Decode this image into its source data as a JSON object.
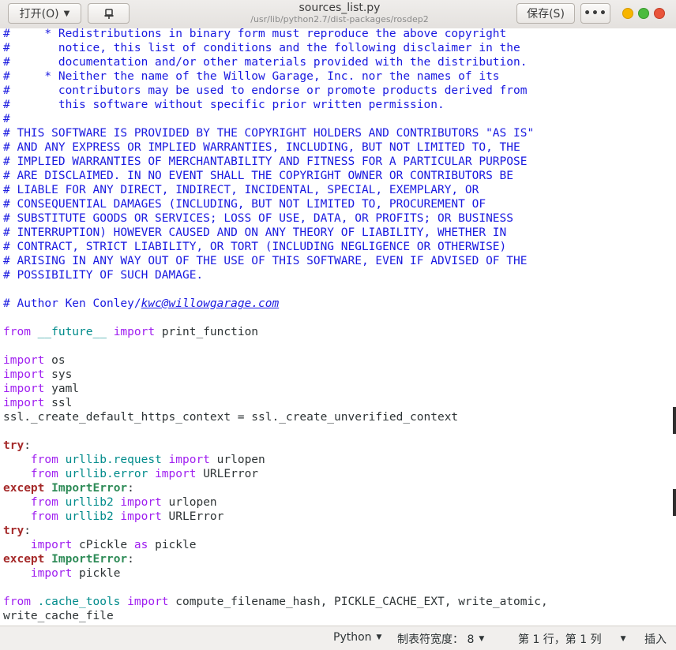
{
  "header": {
    "open_label": "打开(O)",
    "pin_icon": "pin-icon",
    "title": "sources_list.py",
    "subtitle": "/usr/lib/python2.7/dist-packages/rosdep2",
    "save_label": "保存(S)",
    "menu_label": "•••",
    "colors": {
      "minimize": "#f7b500",
      "maximize": "#4cbb3f",
      "close": "#e9543a"
    }
  },
  "editor": {
    "lines": [
      [
        [
          "c",
          "#     * Redistributions in binary form must reproduce the above copyright"
        ]
      ],
      [
        [
          "c",
          "#       notice, this list of conditions and the following disclaimer in the"
        ]
      ],
      [
        [
          "c",
          "#       documentation and/or other materials provided with the distribution."
        ]
      ],
      [
        [
          "c",
          "#     * Neither the name of the Willow Garage, Inc. nor the names of its"
        ]
      ],
      [
        [
          "c",
          "#       contributors may be used to endorse or promote products derived from"
        ]
      ],
      [
        [
          "c",
          "#       this software without specific prior written permission."
        ]
      ],
      [
        [
          "c",
          "#"
        ]
      ],
      [
        [
          "c",
          "# THIS SOFTWARE IS PROVIDED BY THE COPYRIGHT HOLDERS AND CONTRIBUTORS \"AS IS\""
        ]
      ],
      [
        [
          "c",
          "# AND ANY EXPRESS OR IMPLIED WARRANTIES, INCLUDING, BUT NOT LIMITED TO, THE"
        ]
      ],
      [
        [
          "c",
          "# IMPLIED WARRANTIES OF MERCHANTABILITY AND FITNESS FOR A PARTICULAR PURPOSE"
        ]
      ],
      [
        [
          "c",
          "# ARE DISCLAIMED. IN NO EVENT SHALL THE COPYRIGHT OWNER OR CONTRIBUTORS BE"
        ]
      ],
      [
        [
          "c",
          "# LIABLE FOR ANY DIRECT, INDIRECT, INCIDENTAL, SPECIAL, EXEMPLARY, OR"
        ]
      ],
      [
        [
          "c",
          "# CONSEQUENTIAL DAMAGES (INCLUDING, BUT NOT LIMITED TO, PROCUREMENT OF"
        ]
      ],
      [
        [
          "c",
          "# SUBSTITUTE GOODS OR SERVICES; LOSS OF USE, DATA, OR PROFITS; OR BUSINESS"
        ]
      ],
      [
        [
          "c",
          "# INTERRUPTION) HOWEVER CAUSED AND ON ANY THEORY OF LIABILITY, WHETHER IN"
        ]
      ],
      [
        [
          "c",
          "# CONTRACT, STRICT LIABILITY, OR TORT (INCLUDING NEGLIGENCE OR OTHERWISE)"
        ]
      ],
      [
        [
          "c",
          "# ARISING IN ANY WAY OUT OF THE USE OF THIS SOFTWARE, EVEN IF ADVISED OF THE"
        ]
      ],
      [
        [
          "c",
          "# POSSIBILITY OF SUCH DAMAGE."
        ]
      ],
      [],
      [
        [
          "c",
          "# Author Ken Conley/"
        ],
        [
          "em",
          "kwc@willowgarage.com"
        ]
      ],
      [],
      [
        [
          "k",
          "from"
        ],
        [
          "",
          " "
        ],
        [
          "m",
          "__future__"
        ],
        [
          "",
          " "
        ],
        [
          "k",
          "import"
        ],
        [
          "",
          " print_function"
        ]
      ],
      [],
      [
        [
          "k",
          "import"
        ],
        [
          "",
          " os"
        ]
      ],
      [
        [
          "k",
          "import"
        ],
        [
          "",
          " sys"
        ]
      ],
      [
        [
          "k",
          "import"
        ],
        [
          "",
          " yaml"
        ]
      ],
      [
        [
          "k",
          "import"
        ],
        [
          "",
          " ssl"
        ]
      ],
      [
        [
          "",
          "ssl._create_default_https_context = ssl._create_unverified_context"
        ]
      ],
      [],
      [
        [
          "kb",
          "try"
        ],
        [
          "",
          ":"
        ]
      ],
      [
        [
          "",
          "    "
        ],
        [
          "k",
          "from"
        ],
        [
          "",
          " "
        ],
        [
          "m",
          "urllib.request"
        ],
        [
          "",
          " "
        ],
        [
          "k",
          "import"
        ],
        [
          "",
          " urlopen"
        ]
      ],
      [
        [
          "",
          "    "
        ],
        [
          "k",
          "from"
        ],
        [
          "",
          " "
        ],
        [
          "m",
          "urllib.error"
        ],
        [
          "",
          " "
        ],
        [
          "k",
          "import"
        ],
        [
          "",
          " URLError"
        ]
      ],
      [
        [
          "kb",
          "except"
        ],
        [
          "",
          " "
        ],
        [
          "e",
          "ImportError"
        ],
        [
          "",
          ":"
        ]
      ],
      [
        [
          "",
          "    "
        ],
        [
          "k",
          "from"
        ],
        [
          "",
          " "
        ],
        [
          "m",
          "urllib2"
        ],
        [
          "",
          " "
        ],
        [
          "k",
          "import"
        ],
        [
          "",
          " urlopen"
        ]
      ],
      [
        [
          "",
          "    "
        ],
        [
          "k",
          "from"
        ],
        [
          "",
          " "
        ],
        [
          "m",
          "urllib2"
        ],
        [
          "",
          " "
        ],
        [
          "k",
          "import"
        ],
        [
          "",
          " URLError"
        ]
      ],
      [
        [
          "kb",
          "try"
        ],
        [
          "",
          ":"
        ]
      ],
      [
        [
          "",
          "    "
        ],
        [
          "k",
          "import"
        ],
        [
          "",
          " cPickle "
        ],
        [
          "k",
          "as"
        ],
        [
          "",
          " pickle"
        ]
      ],
      [
        [
          "kb",
          "except"
        ],
        [
          "",
          " "
        ],
        [
          "e",
          "ImportError"
        ],
        [
          "",
          ":"
        ]
      ],
      [
        [
          "",
          "    "
        ],
        [
          "k",
          "import"
        ],
        [
          "",
          " pickle"
        ]
      ],
      [],
      [
        [
          "k",
          "from"
        ],
        [
          "",
          " "
        ],
        [
          "m",
          ".cache_tools"
        ],
        [
          "",
          " "
        ],
        [
          "k",
          "import"
        ],
        [
          "",
          " compute_filename_hash, PICKLE_CACHE_EXT, write_atomic,"
        ]
      ],
      [
        [
          "",
          "write_cache_file"
        ]
      ]
    ]
  },
  "status": {
    "language": "Python",
    "tab_width": "制表符宽度： 8",
    "position": "第 1 行，第 1 列",
    "mode": "插入"
  }
}
